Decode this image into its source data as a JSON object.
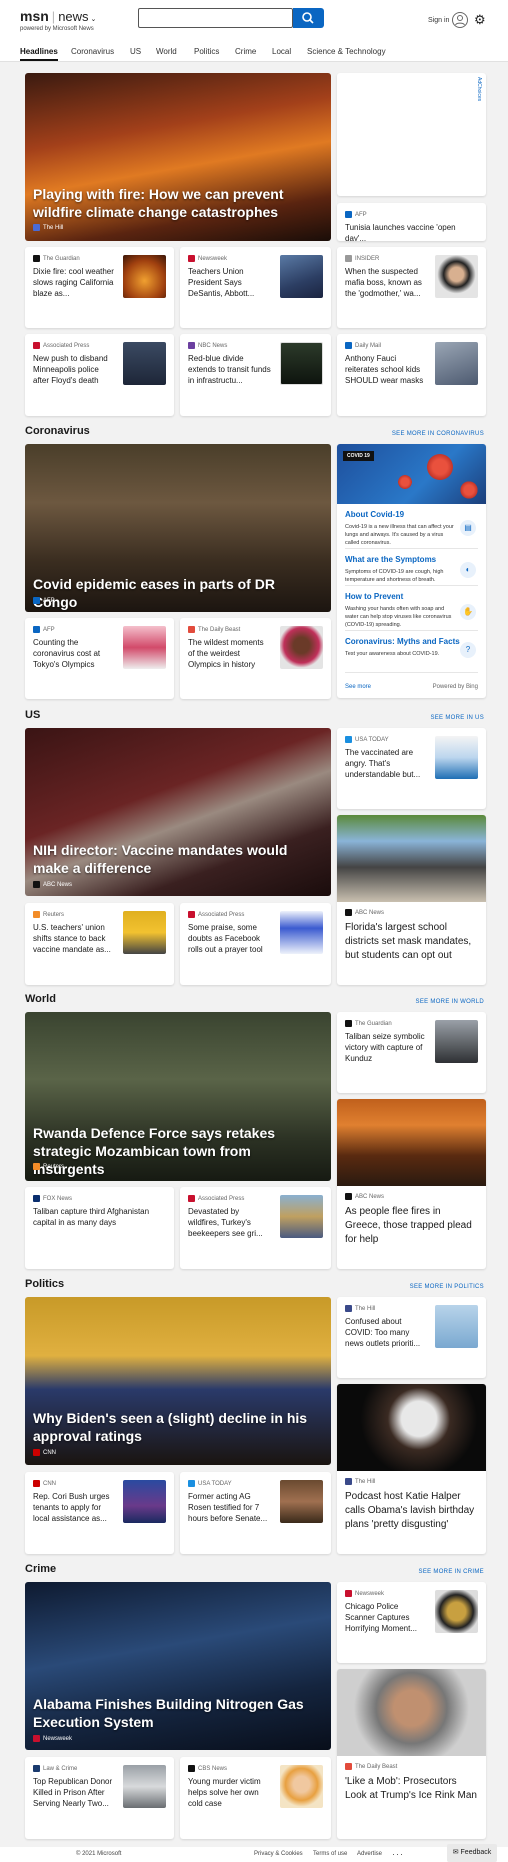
{
  "header": {
    "brand": "msn",
    "section": "news",
    "powered_by": "powered by Microsoft News",
    "search_placeholder": "",
    "sign_in": "Sign in"
  },
  "nav": [
    "Headlines",
    "Coronavirus",
    "US",
    "World",
    "Politics",
    "Crime",
    "Local",
    "Science & Technology"
  ],
  "headlines": {
    "hero": {
      "title": "Playing with fire: How we can prevent wildfire climate change catastrophes",
      "source": "The Hill"
    },
    "ad_label": "AdChoices",
    "side_small": {
      "source": "AFP",
      "title": "Tunisia launches vaccine 'open day'..."
    },
    "row1": [
      {
        "source": "The Guardian",
        "title": "Dixie fire: cool weather slows raging California blaze as..."
      },
      {
        "source": "Newsweek",
        "title": "Teachers Union President Says DeSantis, Abbott..."
      },
      {
        "source": "INSIDER",
        "title": "When the suspected mafia boss, known as the 'godmother,' wa..."
      }
    ],
    "row2": [
      {
        "source": "Associated Press",
        "title": "New push to disband Minneapolis police after Floyd's death"
      },
      {
        "source": "NBC News",
        "title": "Red-blue divide extends to transit funds in infrastructu..."
      },
      {
        "source": "Daily Mail",
        "title": "Anthony Fauci reiterates school kids SHOULD wear masks"
      }
    ]
  },
  "coronavirus": {
    "label": "Coronavirus",
    "see_more": "SEE MORE IN CORONAVIRUS",
    "hero": {
      "title": "Covid epidemic eases in parts of DR Congo",
      "source": "AFP"
    },
    "widget": {
      "badge": "COVID 19",
      "items": [
        {
          "title": "About Covid-19",
          "text": "Covid-19 is a new illness that can affect your lungs and airways. It's caused by a virus called coronavirus."
        },
        {
          "title": "What are the Symptoms",
          "text": "Symptoms of COVID-19 are cough, high temperature and shortness of breath."
        },
        {
          "title": "How to Prevent",
          "text": "Washing your hands often with soap and water can help stop viruses like coronavirus (COVID-19) spreading."
        },
        {
          "title": "Coronavirus: Myths and Facts",
          "text": "Test your awareness about COVID-19."
        }
      ],
      "see_more": "See more",
      "powered": "Powered by Bing"
    },
    "cards": [
      {
        "source": "AFP",
        "title": "Counting the coronavirus cost at Tokyo's Olympics"
      },
      {
        "source": "The Daily Beast",
        "title": "The wildest moments of the weirdest Olympics in history"
      }
    ]
  },
  "us": {
    "label": "US",
    "see_more": "SEE MORE IN US",
    "hero": {
      "title": "NIH director: Vaccine mandates would make a difference",
      "source": "ABC News"
    },
    "side_card": {
      "source": "USA TODAY",
      "title": "The vaccinated are angry. That's understandable but..."
    },
    "tall_card": {
      "source": "ABC News",
      "title": "Florida's largest school districts set mask mandates, but students can opt out"
    },
    "cards": [
      {
        "source": "Reuters",
        "title": "U.S. teachers' union shifts stance to back vaccine mandate as..."
      },
      {
        "source": "Associated Press",
        "title": "Some praise, some doubts as Facebook rolls out a prayer tool"
      }
    ]
  },
  "world": {
    "label": "World",
    "see_more": "SEE MORE IN WORLD",
    "hero": {
      "title": "Rwanda Defence Force says retakes strategic Mozambican town from insurgents",
      "source": "Reuters"
    },
    "side_card": {
      "source": "The Guardian",
      "title": "Taliban seize symbolic victory with capture of Kunduz"
    },
    "tall_card": {
      "source": "ABC News",
      "title": "As people flee fires in Greece, those trapped plead for help"
    },
    "cards": [
      {
        "source": "FOX News",
        "title": "Taliban capture third Afghanistan capital in as many days"
      },
      {
        "source": "Associated Press",
        "title": "Devastated by wildfires, Turkey's beekeepers see gri..."
      }
    ]
  },
  "politics": {
    "label": "Politics",
    "see_more": "SEE MORE IN POLITICS",
    "hero": {
      "title": "Why Biden's seen a (slight) decline in his approval ratings",
      "source": "CNN"
    },
    "side_card": {
      "source": "The Hill",
      "title": "Confused about COVID: Too many news outlets prioriti..."
    },
    "tall_card": {
      "source": "The Hill",
      "title": "Podcast host Katie Halper calls Obama's lavish birthday plans 'pretty disgusting'"
    },
    "cards": [
      {
        "source": "CNN",
        "title": "Rep. Cori Bush urges tenants to apply for local assistance as..."
      },
      {
        "source": "USA TODAY",
        "title": "Former acting AG Rosen testified for 7 hours before Senate..."
      }
    ]
  },
  "crime": {
    "label": "Crime",
    "see_more": "SEE MORE IN CRIME",
    "hero": {
      "title": "Alabama Finishes Building Nitrogen Gas Execution System",
      "source": "Newsweek"
    },
    "side_card": {
      "source": "Newsweek",
      "title": "Chicago Police Scanner Captures Horrifying Moment..."
    },
    "tall_card": {
      "source": "The Daily Beast",
      "title": "'Like a Mob': Prosecutors Look at Trump's Ice Rink Man"
    },
    "cards": [
      {
        "source": "Law & Crime",
        "title": "Top Republican Donor Killed in Prison After Serving Nearly Two..."
      },
      {
        "source": "CBS News",
        "title": "Young murder victim helps solve her own cold case"
      }
    ]
  },
  "footer": {
    "copyright": "© 2021 Microsoft",
    "links": [
      "Privacy & Cookies",
      "Terms of use",
      "Advertise",
      "···"
    ],
    "feedback": "Feedback"
  },
  "colors": {
    "accent": "#0a66c2",
    "background": "#f2f2f2"
  }
}
